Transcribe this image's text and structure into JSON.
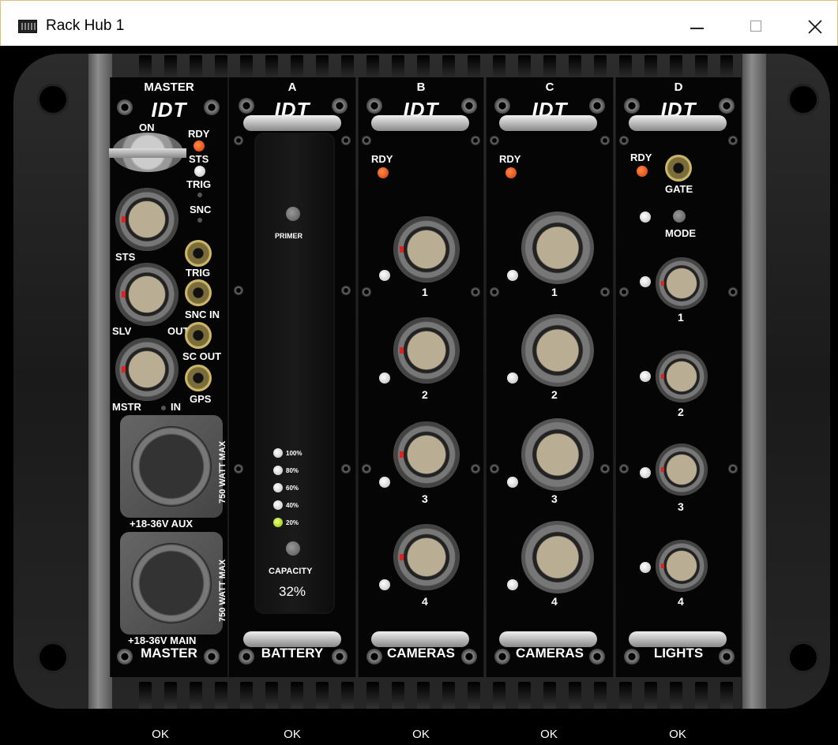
{
  "window": {
    "title": "Rack Hub 1"
  },
  "master": {
    "header": "MASTER",
    "brand": "IDT",
    "labels": {
      "on": "ON",
      "rdy": "RDY",
      "sts": "STS",
      "trig": "TRIG",
      "snc": "SNC",
      "sts_conn": "STS",
      "trig_jack": "TRIG",
      "slv": "SLV",
      "out": "OUT",
      "snc_in": "SNC IN",
      "sc_out": "SC OUT",
      "mstr": "MSTR",
      "in": "IN",
      "gps": "GPS"
    },
    "aux_power": {
      "label": "+18-36V AUX",
      "rating": "750 WATT MAX"
    },
    "main_power": {
      "label": "+18-36V MAIN",
      "rating": "750 WATT MAX"
    },
    "caption": "MASTER"
  },
  "battery": {
    "header": "A",
    "brand": "IDT",
    "primer": "PRIMER",
    "levels": [
      "100%",
      "80%",
      "60%",
      "40%",
      "20%"
    ],
    "active_level": "20%",
    "capacity_label": "CAPACITY",
    "capacity_value": "32%",
    "caption": "BATTERY"
  },
  "cameras_b": {
    "header": "B",
    "brand": "IDT",
    "rdy": "RDY",
    "ports": [
      "1",
      "2",
      "3",
      "4"
    ],
    "caption": "CAMERAS"
  },
  "cameras_c": {
    "header": "C",
    "brand": "IDT",
    "rdy": "RDY",
    "ports": [
      "1",
      "2",
      "3",
      "4"
    ],
    "caption": "CAMERAS"
  },
  "lights_d": {
    "header": "D",
    "brand": "IDT",
    "rdy": "RDY",
    "gate": "GATE",
    "mode": "MODE",
    "ports": [
      "1",
      "2",
      "3",
      "4"
    ],
    "caption": "LIGHTS"
  },
  "status_row": [
    "OK",
    "OK",
    "OK",
    "OK",
    "OK"
  ],
  "colors": {
    "led_red": "#e0501a",
    "led_green": "#c8f040",
    "panel": "#050505"
  }
}
